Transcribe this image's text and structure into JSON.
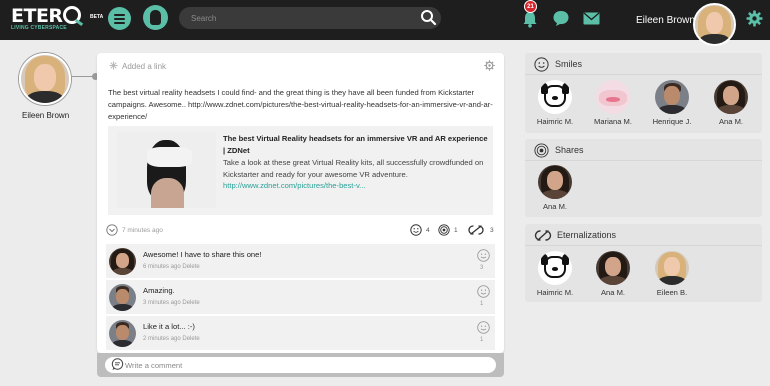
{
  "header": {
    "logo_text": "ETER",
    "logo_beta": "BETA",
    "logo_tagline": "LIVING CYBERSPACE",
    "search_placeholder": "Search",
    "notification_count": "21",
    "user_name": "Eileen Brown",
    "icons": [
      "menu-icon",
      "etero-icon",
      "search-icon",
      "bell-icon",
      "chat-icon",
      "mail-icon",
      "gear-icon"
    ]
  },
  "profile": {
    "name": "Eileen Brown"
  },
  "post": {
    "added_link": "Added a link",
    "text": "The best virtual reality headsets I could find- and the great thing is they have all been funded from Kickstarter campaigns. Awesome.. http://www.zdnet.com/pictures/the-best-virtual-reality-headsets-for-an-immersive-vr-and-ar-experience/",
    "preview": {
      "title": "The best Virtual Reality headsets for an immersive VR and AR experience | ZDNet",
      "description": "Take a look at these great Virtual Reality kits, all successfully crowdfunded on Kickstarter and ready for your awesome VR adventure.",
      "url": "http://www.zdnet.com/pictures/the-best-v..."
    },
    "time": "7 minutes ago",
    "smiles": "4",
    "shares": "1",
    "eternalizations": "3"
  },
  "comments": [
    {
      "text": "Awesome! I have to share this one!",
      "time": "6 minutes ago",
      "delete": "Delete",
      "smiles": "3"
    },
    {
      "text": "Amazing.",
      "time": "3 minutes ago",
      "delete": "Delete",
      "smiles": "1"
    },
    {
      "text": "Like it a lot... :-)",
      "time": "2 minutes ago",
      "delete": "Delete",
      "smiles": "1"
    }
  ],
  "write_comment_placeholder": "Write a comment",
  "panels": {
    "smiles": {
      "title": "Smiles",
      "people": [
        {
          "name": "Haimric M."
        },
        {
          "name": "Mariana M."
        },
        {
          "name": "Henrique J."
        },
        {
          "name": "Ana M."
        }
      ]
    },
    "shares": {
      "title": "Shares",
      "people": [
        {
          "name": "Ana M."
        }
      ]
    },
    "eternalizations": {
      "title": "Eternalizations",
      "people": [
        {
          "name": "Haimric M."
        },
        {
          "name": "Ana M."
        },
        {
          "name": "Eileen B."
        }
      ]
    }
  },
  "colors": {
    "accent": "#5bbfa8",
    "topbar": "#1e1e1e",
    "badge": "#d6262d",
    "link": "#2aa198"
  }
}
